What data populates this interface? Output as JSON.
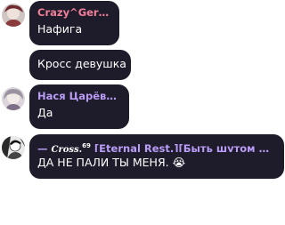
{
  "messages": [
    {
      "author": "Crazy^Gersog",
      "author_color": "#f07f98",
      "text": "Нафига"
    },
    {
      "text": "Кросс девушка"
    },
    {
      "author": "Нася Царёва",
      "author_icon": "💕",
      "author_color": "#b99cf6",
      "text": "Да"
    },
    {
      "author_prefix": "—",
      "author_logo": "Cross.",
      "author_sup": "69",
      "author_rest": "[Eternal Rest.][Быть шутом моя ...",
      "author_color": "#b99cf6",
      "text": "ДА НЕ ПАЛИ ТЫ МЕНЯ.",
      "emoji": "😭"
    }
  ]
}
